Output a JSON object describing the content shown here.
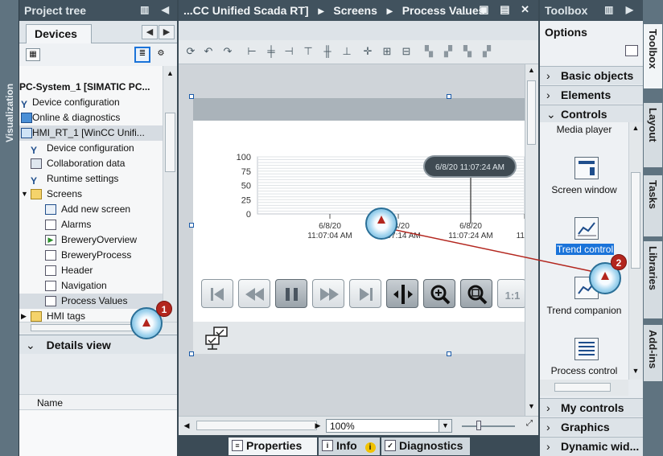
{
  "left_strip": {
    "label": "Visualization"
  },
  "project_tree": {
    "title": "Project tree",
    "tab": "Devices",
    "items": [
      {
        "label": "PC-System_1 [SIMATIC PC..."
      },
      {
        "label": "Device configuration"
      },
      {
        "label": "Online & diagnostics"
      },
      {
        "label": "HMI_RT_1 [WinCC Unifi..."
      },
      {
        "label": "Device configuration"
      },
      {
        "label": "Collaboration data"
      },
      {
        "label": "Runtime settings"
      },
      {
        "label": "Screens"
      },
      {
        "label": "Add new screen"
      },
      {
        "label": "Alarms"
      },
      {
        "label": "BreweryOverview"
      },
      {
        "label": "BreweryProcess"
      },
      {
        "label": "Header"
      },
      {
        "label": "Navigation"
      },
      {
        "label": "Process Values"
      },
      {
        "label": "HMI tags"
      }
    ],
    "details_view": "Details view",
    "details_column": "Name"
  },
  "editor": {
    "breadcrumb": [
      "...CC Unified Scada RT]",
      "Screens",
      "Process Values"
    ],
    "zoom": "100%",
    "trend": {
      "tooltip": "6/8/20 11:07:24 AM",
      "y_ticks": [
        "100",
        "75",
        "50",
        "25",
        "0"
      ],
      "x_ticks": [
        {
          "date": "6/8/20",
          "time": "11:07:04 AM"
        },
        {
          "date": "6/8/20",
          "time": "11:07:14 AM"
        },
        {
          "date": "6/8/20",
          "time": "11:07:24 AM"
        },
        {
          "date": "",
          "time": "11"
        }
      ]
    },
    "media_buttons": {
      "ratio_label": "1:1"
    }
  },
  "bottom_tabs": {
    "properties": "Properties",
    "info": "Info",
    "diagnostics": "Diagnostics"
  },
  "toolbox": {
    "title": "Toolbox",
    "options": "Options",
    "sections": [
      "Basic objects",
      "Elements",
      "Controls"
    ],
    "controls": [
      "Media player",
      "Screen window",
      "Trend control",
      "Trend companion",
      "Process control"
    ],
    "lower_sections": [
      "My controls",
      "Graphics",
      "Dynamic wid..."
    ]
  },
  "right_tabs": [
    "Toolbox",
    "Layout",
    "Tasks",
    "Libraries",
    "Add-ins"
  ],
  "callouts": [
    "1",
    "2"
  ],
  "colors": {
    "title_bar": "#41525e",
    "selection": "#1a73d9",
    "badge": "#b3261e"
  }
}
